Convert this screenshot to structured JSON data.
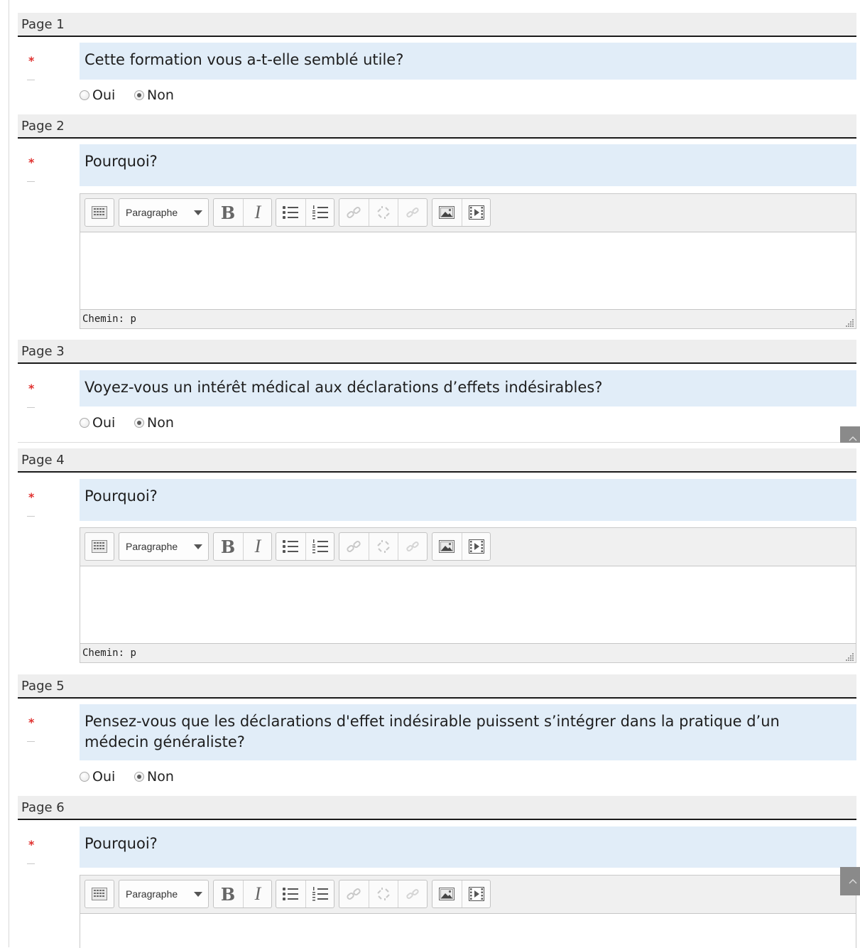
{
  "pages": [
    {
      "header": "Page 1",
      "question": "Cette formation vous a-t-elle semblé utile?",
      "type": "radio",
      "options": [
        {
          "label": "Oui",
          "checked": false
        },
        {
          "label": "Non",
          "checked": true
        }
      ]
    },
    {
      "header": "Page 2",
      "question": "Pourquoi?",
      "type": "editor"
    },
    {
      "header": "Page 3",
      "question": "Voyez-vous un intérêt médical aux déclarations d’effets indésirables?",
      "type": "radio",
      "options": [
        {
          "label": "Oui",
          "checked": false
        },
        {
          "label": "Non",
          "checked": true
        }
      ]
    },
    {
      "header": "Page 4",
      "question": "Pourquoi?",
      "type": "editor"
    },
    {
      "header": "Page 5",
      "question": "Pensez-vous que les déclarations d'effet indésirable puissent s’intégrer dans la pratique d’un médecin généraliste?",
      "type": "radio",
      "options": [
        {
          "label": "Oui",
          "checked": false
        },
        {
          "label": "Non",
          "checked": true
        }
      ]
    },
    {
      "header": "Page 6",
      "question": "Pourquoi?",
      "type": "editor"
    }
  ],
  "required_marker": "*",
  "editor": {
    "format_label": "Paragraphe",
    "bold_glyph": "B",
    "italic_glyph": "I",
    "path_label": "Chemin:",
    "path_value": "p"
  },
  "icons": {
    "toolbar_toggle": "keyboard-grid-icon",
    "unordered_list": "bullet-list-icon",
    "ordered_list": "numbered-list-icon",
    "link": "link-icon",
    "unlink": "unlink-icon",
    "anchor": "anchor-link-icon",
    "image": "image-icon",
    "media": "media-film-icon",
    "scroll_top": "chevron-up-icon"
  },
  "colors": {
    "question_bg": "#e1edf8",
    "header_bg": "#eeeeee",
    "required": "#e0302e",
    "scroll_button": "#8a8a8a"
  }
}
